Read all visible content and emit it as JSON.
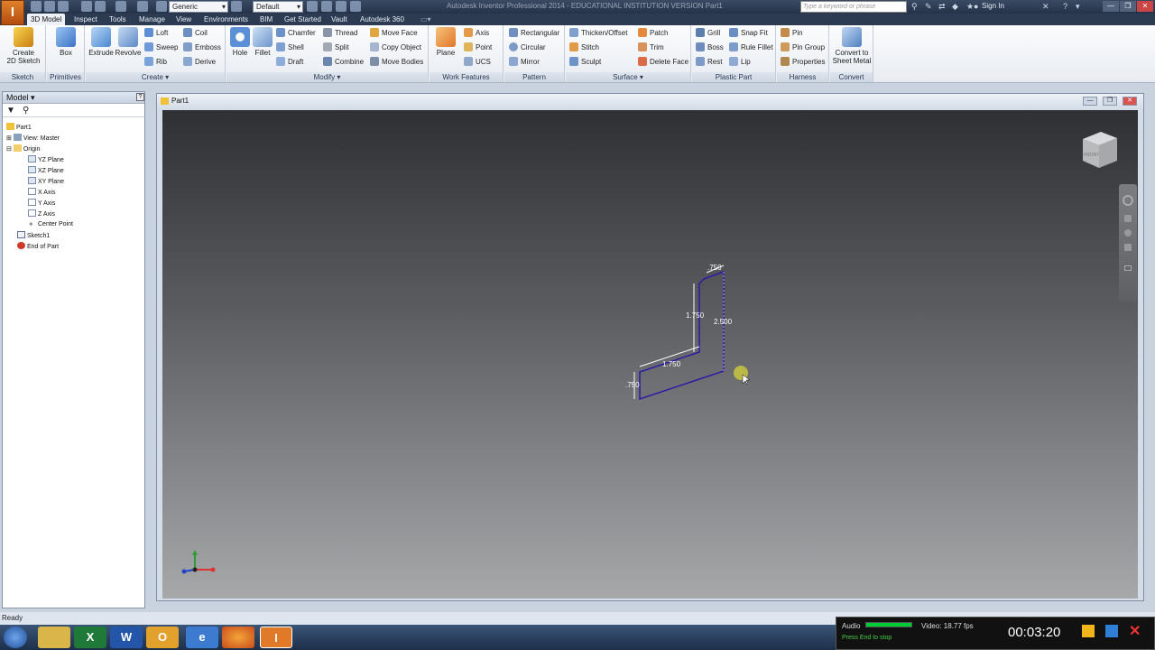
{
  "titlebar": {
    "app_logo": "I",
    "window_title": "Autodesk Inventor Professional 2014 - EDUCATIONAL INSTITUTION VERSION    Part1",
    "material": "Generic",
    "appearance": "Default",
    "search_placeholder": "Type a keyword or phrase",
    "sign_in": "Sign In"
  },
  "tabs": [
    "3D Model",
    "Inspect",
    "Tools",
    "Manage",
    "View",
    "Environments",
    "BIM",
    "Get Started",
    "Vault",
    "Autodesk 360"
  ],
  "ribbon": {
    "sketch": {
      "title": "Sketch",
      "create_2d_sketch": "Create\n2D Sketch"
    },
    "primitives": {
      "title": "Primitives",
      "box": "Box"
    },
    "create": {
      "title": "Create ▾",
      "extrude": "Extrude",
      "revolve": "Revolve",
      "loft": "Loft",
      "sweep": "Sweep",
      "rib": "Rib",
      "coil": "Coil",
      "emboss": "Emboss",
      "derive": "Derive"
    },
    "modify": {
      "title": "Modify ▾",
      "hole": "Hole",
      "fillet": "Fillet",
      "chamfer": "Chamfer",
      "shell": "Shell",
      "draft": "Draft",
      "thread": "Thread",
      "split": "Split",
      "combine": "Combine",
      "move_face": "Move Face",
      "copy_object": "Copy Object",
      "move_bodies": "Move Bodies"
    },
    "work_features": {
      "title": "Work Features",
      "plane": "Plane",
      "axis": "Axis",
      "point": "Point",
      "ucs": "UCS"
    },
    "pattern": {
      "title": "Pattern",
      "rectangular": "Rectangular",
      "circular": "Circular",
      "mirror": "Mirror"
    },
    "surface": {
      "title": "Surface ▾",
      "thicken_offset": "Thicken/Offset",
      "stitch": "Stitch",
      "sculpt": "Sculpt",
      "patch": "Patch",
      "trim": "Trim",
      "delete_face": "Delete Face"
    },
    "plastic_part": {
      "title": "Plastic Part",
      "grill": "Grill",
      "boss": "Boss",
      "rest": "Rest",
      "snap_fit": "Snap Fit",
      "rule_fillet": "Rule Fillet",
      "lip": "Lip"
    },
    "harness": {
      "title": "Harness",
      "pin": "Pin",
      "pin_group": "Pin Group",
      "properties": "Properties"
    },
    "convert": {
      "title": "Convert",
      "convert_to_sheet_metal": "Convert to\nSheet Metal"
    }
  },
  "model": {
    "header": "Model ▾",
    "tree": [
      "Part1",
      "View: Master",
      "Origin",
      "YZ Plane",
      "XZ Plane",
      "XY Plane",
      "X Axis",
      "Y Axis",
      "Z Axis",
      "Center Point",
      "Sketch1",
      "End of Part"
    ]
  },
  "document": {
    "title": "Part1",
    "view_cube_label": "FRONT"
  },
  "sketch_dims": {
    "top": ".750",
    "left_vertical": "1.750",
    "right_vertical": "2.500",
    "middle": "1.750",
    "bottom": ".750"
  },
  "status": {
    "text": "Ready"
  },
  "recorder": {
    "audio_label": "Audio",
    "video_label": "Video: 18.77 fps",
    "hint": "Press End to stop",
    "time": "00:03:20"
  },
  "taskbar": [
    "Start",
    "Explorer",
    "Excel",
    "Word",
    "Outlook",
    "Internet Explorer",
    "Firefox",
    "Inventor"
  ]
}
